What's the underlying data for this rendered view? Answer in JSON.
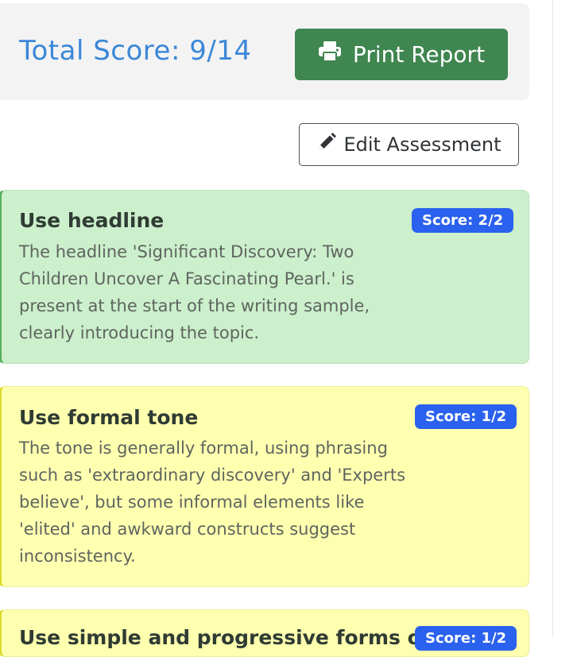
{
  "header": {
    "total_score": "Total Score: 9/14",
    "print_label": "Print Report"
  },
  "actions": {
    "edit_label": "Edit Assessment"
  },
  "criteria": [
    {
      "title": "Use headline",
      "score": "Score: 2/2",
      "status_color": "#ccefcc",
      "comment": "The headline 'Significant Discovery: Two Children Uncover A Fascinating Pearl.' is present at the start of the writing sample, clearly introducing the topic."
    },
    {
      "title": "Use formal tone",
      "score": "Score: 1/2",
      "status_color": "#ffffb0",
      "comment": "The tone is generally formal, using phrasing such as 'extraordinary discovery' and 'Experts believe', but some informal elements like 'elited' and awkward constructs suggest inconsistency."
    },
    {
      "title": "Use simple and progressive forms of",
      "score": "Score: 1/2",
      "status_color": "#ffffb0"
    }
  ],
  "icons": {
    "print": "printer-icon",
    "edit": "pencil-icon"
  }
}
